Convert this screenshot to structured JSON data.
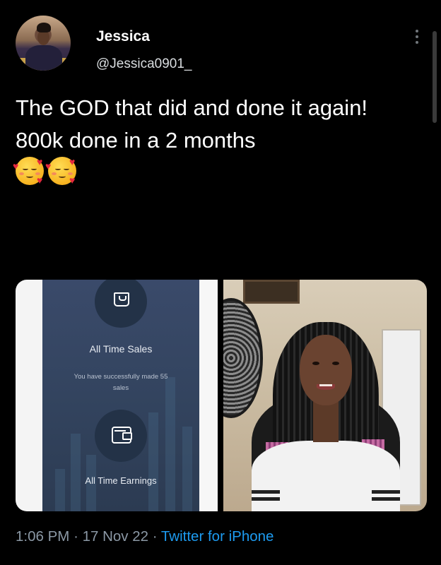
{
  "header": {
    "display_name": "Jessica",
    "username": "@Jessica0901_",
    "avatar_icon": "profile-photo",
    "more_icon": "more-vertical-icon"
  },
  "tweet": {
    "text": "The GOD that did and done it again! 800k done in a 2 months",
    "emojis": [
      "smiling-face-with-hearts",
      "smiling-face-with-hearts"
    ]
  },
  "media": {
    "left_image": {
      "title": "All Time Sales",
      "subtitle": "You have successfully made 55 sales",
      "second_title": "All Time Earnings",
      "icons": [
        "shopping-bag-icon",
        "wallet-icon"
      ]
    },
    "right_image": {
      "description": "photo"
    }
  },
  "footer": {
    "time": "1:06 PM",
    "separator": "·",
    "date": "17 Nov 22",
    "source": "Twitter for iPhone"
  },
  "colors": {
    "background": "#000000",
    "text": "#ffffff",
    "secondary": "#8b98a5",
    "link": "#1d9bf0"
  }
}
